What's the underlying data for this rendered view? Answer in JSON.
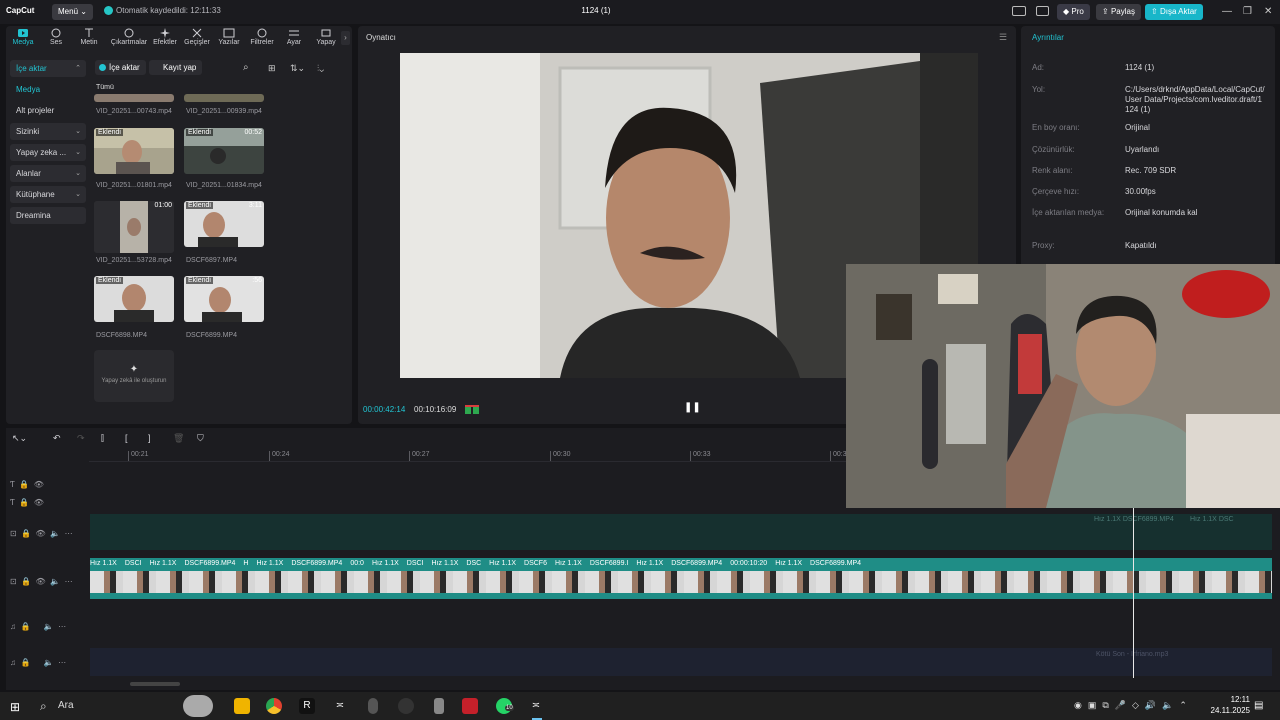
{
  "titlebar": {
    "logo": "CapCut",
    "menu_label": "Menü",
    "autosave_text": "Otomatik kaydedildi: 12:11:33",
    "project_title": "1124 (1)",
    "pro_label": "Pro",
    "share_label": "Paylaş",
    "export_label": "Dışa Aktar"
  },
  "tabs": [
    {
      "label": "Medya",
      "icon": "media-icon"
    },
    {
      "label": "Ses",
      "icon": "audio-icon"
    },
    {
      "label": "Metin",
      "icon": "text-icon"
    },
    {
      "label": "Çıkartmalar",
      "icon": "sticker-icon"
    },
    {
      "label": "Efektler",
      "icon": "effects-icon"
    },
    {
      "label": "Geçişler",
      "icon": "transitions-icon"
    },
    {
      "label": "Yazılar",
      "icon": "captions-icon"
    },
    {
      "label": "Filtreler",
      "icon": "filters-icon"
    },
    {
      "label": "Ayar",
      "icon": "adjust-icon"
    },
    {
      "label": "Yapay",
      "icon": "ai-icon"
    }
  ],
  "sidebar": {
    "items": [
      {
        "label": "İçe aktar",
        "chev": "⌃"
      },
      {
        "label": "Medya",
        "chev": ""
      },
      {
        "label": "Alt projeler",
        "chev": ""
      },
      {
        "label": "Sizinki",
        "chev": "⌄"
      },
      {
        "label": "Yapay zeka ...",
        "chev": "⌄"
      },
      {
        "label": "Alanlar",
        "chev": "⌄"
      },
      {
        "label": "Kütüphane",
        "chev": "⌄"
      },
      {
        "label": "Dreamina",
        "chev": ""
      }
    ]
  },
  "media_panel": {
    "import_label": "İçe aktar",
    "record_label": "Kayıt yap",
    "all_label": "Tümü",
    "clips": [
      {
        "name": "VID_20251...00743.mp4",
        "badge": "",
        "duration": ""
      },
      {
        "name": "VID_20251...00939.mp4",
        "badge": "",
        "duration": ""
      },
      {
        "name": "VID_20251...01801.mp4",
        "badge": "Eklendi",
        "duration": ""
      },
      {
        "name": "VID_20251...01834.mp4",
        "badge": "Eklendi",
        "duration": "00:52"
      },
      {
        "name": "VID_20251...53728.mp4",
        "badge": "",
        "duration": "01:00"
      },
      {
        "name": "DSCF6897.MP4",
        "badge": "Eklendi",
        "duration": "3:11"
      },
      {
        "name": "DSCF6898.MP4",
        "badge": "Eklendi",
        "duration": ""
      },
      {
        "name": "DSCF6899.MP4",
        "badge": "Eklendi",
        "duration": ":56"
      }
    ],
    "ai_create_label": "Yapay zekâ ile oluşturun"
  },
  "player": {
    "title": "Oynatıcı",
    "current_time": "00:00:42:14",
    "total_time": "00:10:16:09"
  },
  "details": {
    "title": "Ayrıntılar",
    "rows": [
      {
        "key": "Ad:",
        "value": "1124 (1)"
      },
      {
        "key": "Yol:",
        "value": "C:/Users/drknd/AppData/Local/CapCut/User Data/Projects/com.lveditor.draft/1124 (1)"
      },
      {
        "key": "En boy oranı:",
        "value": "Orijinal"
      },
      {
        "key": "Çözünürlük:",
        "value": "Uyarlandı"
      },
      {
        "key": "Renk alanı:",
        "value": "Rec. 709 SDR"
      },
      {
        "key": "Çerçeve hızı:",
        "value": "30.00fps"
      },
      {
        "key": "İçe aktarılan medya:",
        "value": "Orijinal konumda kal"
      },
      {
        "key": "Proxy:",
        "value": "Kapatıldı"
      }
    ]
  },
  "timeline": {
    "ruler_ticks": [
      "00:21",
      "00:24",
      "00:27",
      "00:30",
      "00:33",
      "00:3"
    ],
    "overlay_clip_labels": [
      "Hız 1.1X",
      "DSCF6899.MP4",
      "Hız 1.1X",
      "DSC"
    ],
    "main_clip_labels": [
      "Hız 1.1X",
      "DSCI",
      "Hız 1.1X",
      "DSCF6899.MP4",
      "H",
      "Hız 1.1X",
      "DSCF6899.MP4",
      "00:0",
      "Hız 1.1X",
      "DSCI",
      "Hız 1.1X",
      "DSC",
      "Hız 1.1X",
      "DSCF6",
      "Hız 1.1X",
      "DSCF6899.I",
      "Hız 1.1X",
      "DSCF6899.MP4",
      "00:00:10:20",
      "Hız 1.1X",
      "DSCF6899.MP4"
    ],
    "audio_label": "Kötü Son - Irfriano.mp3"
  },
  "taskbar": {
    "search_placeholder": "Ara",
    "time": "12:11",
    "date": "24.11.2025",
    "whatsapp_badge": "10"
  },
  "colors": {
    "accent": "#22c4d2",
    "clip_teal": "#1f8d86",
    "export_bg": "#18b6c9"
  }
}
